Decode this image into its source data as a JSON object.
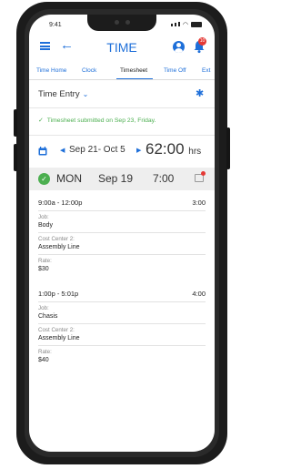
{
  "status_bar": {
    "time": "9:41"
  },
  "header": {
    "title": "TIME",
    "notification_count": "10"
  },
  "tabs": [
    {
      "label": "Time Home"
    },
    {
      "label": "Clock"
    },
    {
      "label": "Timesheet"
    },
    {
      "label": "Time Off"
    },
    {
      "label": "Ext"
    }
  ],
  "section": {
    "title": "Time Entry",
    "chevron": "⌄"
  },
  "notice": {
    "text": "Timesheet submitted on Sep 23, Friday."
  },
  "period": {
    "range": "Sep 21- Oct 5",
    "total": "62:00",
    "unit": "hrs"
  },
  "day": {
    "name": "MON",
    "date": "Sep 19",
    "total": "7:00"
  },
  "entries": [
    {
      "time_range": "9:00a - 12:00p",
      "hours": "3:00",
      "job_label": "Job:",
      "job_value": "Body",
      "cost_center_label": "Cost Center 2:",
      "cost_center_value": "Assembly Line",
      "rate_label": "Rate:",
      "rate_value": "$30"
    },
    {
      "time_range": "1:00p - 5:01p",
      "hours": "4:00",
      "job_label": "Job:",
      "job_value": "Chasis",
      "cost_center_label": "Cost Center 2:",
      "cost_center_value": "Assembly Line",
      "rate_label": "Rate:",
      "rate_value": "$40"
    }
  ],
  "icons": {
    "menu": "menu-icon",
    "back": "back-arrow-icon",
    "user": "user-icon",
    "bell": "bell-icon",
    "gear": "gear-icon",
    "calendar": "calendar-icon",
    "check": "check-icon",
    "comment": "comment-icon"
  },
  "colors": {
    "accent": "#1e6fd9",
    "success": "#4caf50",
    "alert": "#e53935"
  }
}
